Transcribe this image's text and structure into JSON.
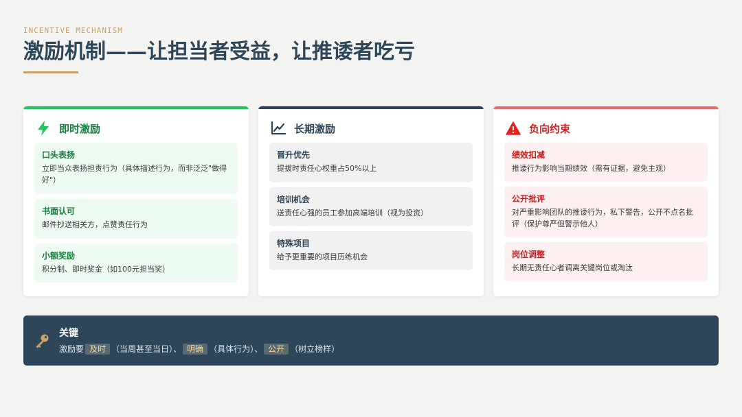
{
  "header": {
    "eyebrow": "INCENTIVE MECHANISM",
    "title": "激励机制——让担当者受益，让推诿者吃亏"
  },
  "cards": [
    {
      "title": "即时激励",
      "icon": "lightning-icon",
      "items": [
        {
          "title": "口头表扬",
          "desc": "立即当众表扬担责行为（具体描述行为，而非泛泛\"做得好\"）"
        },
        {
          "title": "书面认可",
          "desc": "邮件抄送相关方，点赞责任行为"
        },
        {
          "title": "小额奖励",
          "desc": "积分制、即时奖金（如100元担当奖）"
        }
      ]
    },
    {
      "title": "长期激励",
      "icon": "chart-line-icon",
      "items": [
        {
          "title": "晋升优先",
          "desc": "提拔时责任心权重占50%以上"
        },
        {
          "title": "培训机会",
          "desc": "送责任心强的员工参加高端培训（视为投资）"
        },
        {
          "title": "特殊项目",
          "desc": "给予更重要的项目历练机会"
        }
      ]
    },
    {
      "title": "负向约束",
      "icon": "warning-icon",
      "items": [
        {
          "title": "绩效扣减",
          "desc": "推诿行为影响当期绩效（需有证据，避免主观）"
        },
        {
          "title": "公开批评",
          "desc": "对严重影响团队的推诿行为，私下警告，公开不点名批评（保护尊严但警示他人）"
        },
        {
          "title": "岗位调整",
          "desc": "长期无责任心者调离关键岗位或淘汰"
        }
      ]
    }
  ],
  "key": {
    "icon": "key-icon",
    "label": "关键",
    "prefix": "激励要",
    "h1": "及时",
    "t1": "（当周甚至当日）、",
    "h2": "明确",
    "t2": "（具体行为）、",
    "h3": "公开",
    "t3": "（树立榜样）"
  },
  "colors": {
    "navy": "#2d4659",
    "gold": "#c9a266",
    "green": "#22c55e",
    "red": "#f26b6b"
  }
}
